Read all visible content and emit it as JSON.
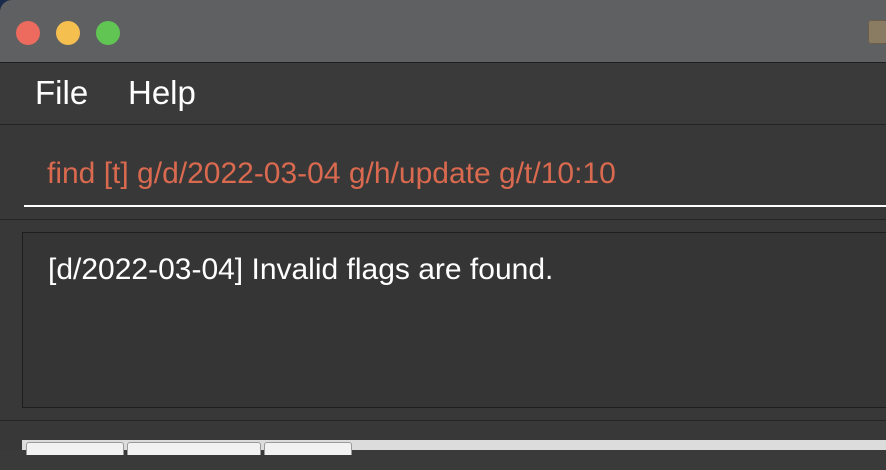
{
  "menu": {
    "file_label": "File",
    "help_label": "Help"
  },
  "command": {
    "value": "find [t] g/d/2022-03-04 g/h/update g/t/10:10",
    "text_color": "#d9694f"
  },
  "result": {
    "message": "[d/2022-03-04] Invalid flags are found."
  },
  "icons": {
    "close": "close-icon",
    "minimize": "minimize-icon",
    "maximize": "maximize-icon",
    "app": "app-icon"
  },
  "colors": {
    "close": "#ed6a5e",
    "minimize": "#f5bf4f",
    "maximize": "#61c554",
    "background": "#3a3a3a"
  }
}
